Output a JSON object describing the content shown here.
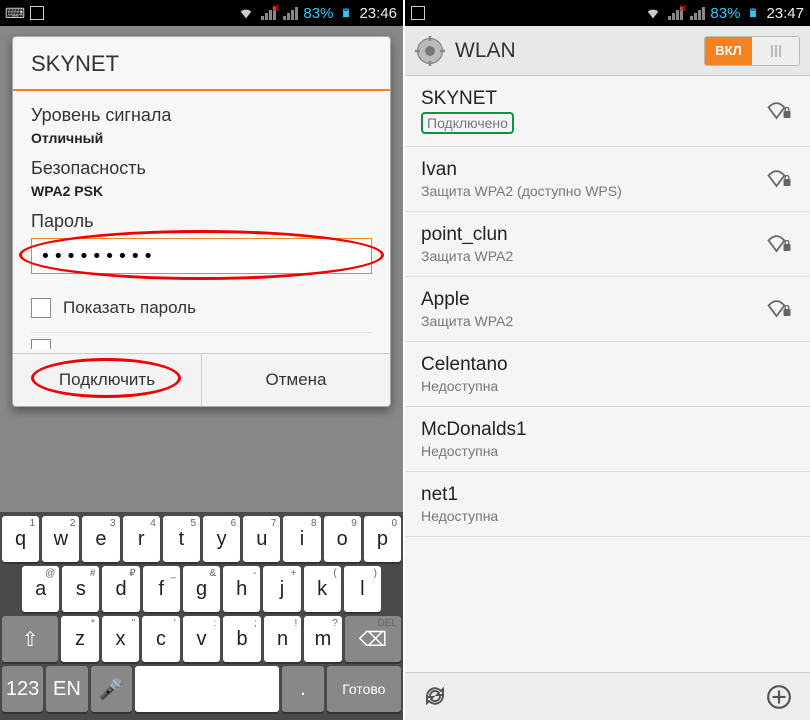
{
  "status_left": {
    "battery": "83%",
    "time": "23:46"
  },
  "status_right": {
    "battery": "83%",
    "time": "23:47"
  },
  "dialog": {
    "title": "SKYNET",
    "signal_label": "Уровень сигнала",
    "signal_value": "Отличный",
    "security_label": "Безопасность",
    "security_value": "WPA2 PSK",
    "password_label": "Пароль",
    "password_value": "•••••••••",
    "show_password": "Показать пароль",
    "connect": "Подключить",
    "cancel": "Отмена"
  },
  "keyboard": {
    "row1": [
      {
        "k": "q",
        "h": "1"
      },
      {
        "k": "w",
        "h": "2"
      },
      {
        "k": "e",
        "h": "3"
      },
      {
        "k": "r",
        "h": "4"
      },
      {
        "k": "t",
        "h": "5"
      },
      {
        "k": "y",
        "h": "6"
      },
      {
        "k": "u",
        "h": "7"
      },
      {
        "k": "i",
        "h": "8"
      },
      {
        "k": "o",
        "h": "9"
      },
      {
        "k": "p",
        "h": "0"
      }
    ],
    "row2": [
      {
        "k": "a",
        "h": "@"
      },
      {
        "k": "s",
        "h": "#"
      },
      {
        "k": "d",
        "h": "₽"
      },
      {
        "k": "f",
        "h": "_"
      },
      {
        "k": "g",
        "h": "&"
      },
      {
        "k": "h",
        "h": "-"
      },
      {
        "k": "j",
        "h": "+"
      },
      {
        "k": "k",
        "h": "("
      },
      {
        "k": "l",
        "h": ")"
      }
    ],
    "row3": [
      {
        "k": "z",
        "h": "*"
      },
      {
        "k": "x",
        "h": "\""
      },
      {
        "k": "c",
        "h": "'"
      },
      {
        "k": "v",
        "h": ":"
      },
      {
        "k": "b",
        "h": ";"
      },
      {
        "k": "n",
        "h": "!"
      },
      {
        "k": "m",
        "h": "?"
      }
    ],
    "numkey": "123",
    "langkey": "EN",
    "done": "Готово",
    "del": "DEL"
  },
  "wlan": {
    "title": "WLAN",
    "toggle_on": "ВКЛ",
    "networks": [
      {
        "name": "SKYNET",
        "status": "Подключено",
        "signal": true,
        "connected": true
      },
      {
        "name": "Ivan",
        "status": "Защита WPA2 (доступно WPS)",
        "signal": true
      },
      {
        "name": "point_clun",
        "status": "Защита WPA2",
        "signal": true
      },
      {
        "name": "Apple",
        "status": "Защита WPA2",
        "signal": true
      },
      {
        "name": "Celentano",
        "status": "Недоступна",
        "signal": false
      },
      {
        "name": "McDonalds1",
        "status": "Недоступна",
        "signal": false
      },
      {
        "name": "net1",
        "status": "Недоступна",
        "signal": false
      }
    ]
  }
}
